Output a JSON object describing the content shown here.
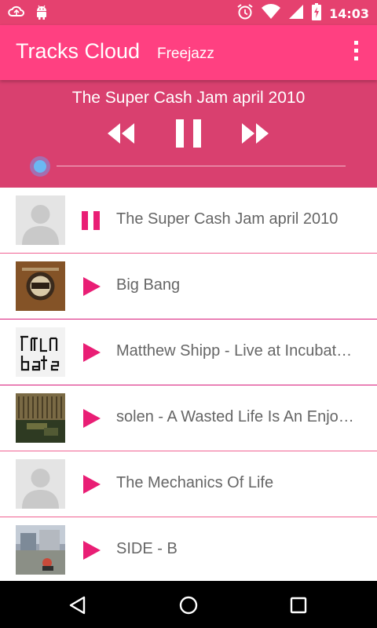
{
  "status_bar": {
    "left_icons": [
      "cloud-sync-icon",
      "android-icon"
    ],
    "right_icons": [
      "alarm-icon",
      "wifi-icon",
      "signal-icon",
      "battery-charging-icon"
    ],
    "time": "14:03"
  },
  "app_bar": {
    "title": "Tracks Cloud",
    "subtitle": "Freejazz",
    "menu_icon": "overflow-menu-icon"
  },
  "player": {
    "now_playing": "The Super Cash Jam april 2010",
    "state": "playing",
    "progress": 0.0
  },
  "tracks": [
    {
      "title": "The Super Cash Jam april 2010",
      "state": "playing",
      "artwork": "avatar-placeholder"
    },
    {
      "title": "Big Bang",
      "state": "stopped",
      "artwork": "album-art-badge"
    },
    {
      "title": "Matthew Shipp - Live at Incubat…",
      "state": "stopped",
      "artwork": "album-art-incubate"
    },
    {
      "title": "solen - A Wasted Life Is An Enjo…",
      "state": "stopped",
      "artwork": "album-art-room"
    },
    {
      "title": "The Mechanics Of Life",
      "state": "stopped",
      "artwork": "avatar-placeholder"
    },
    {
      "title": "SIDE - B",
      "state": "stopped",
      "artwork": "album-art-street"
    }
  ],
  "colors": {
    "status_bar": "#e5416f",
    "app_bar": "#ff4081",
    "player_panel": "#d9406f",
    "accent": "#e91e75",
    "divider": "#f06292",
    "track_text": "#666666",
    "seek_thumb": "#6ab8f3"
  },
  "nav_bar": {
    "icons": [
      "back-icon",
      "home-icon",
      "recents-icon"
    ]
  }
}
